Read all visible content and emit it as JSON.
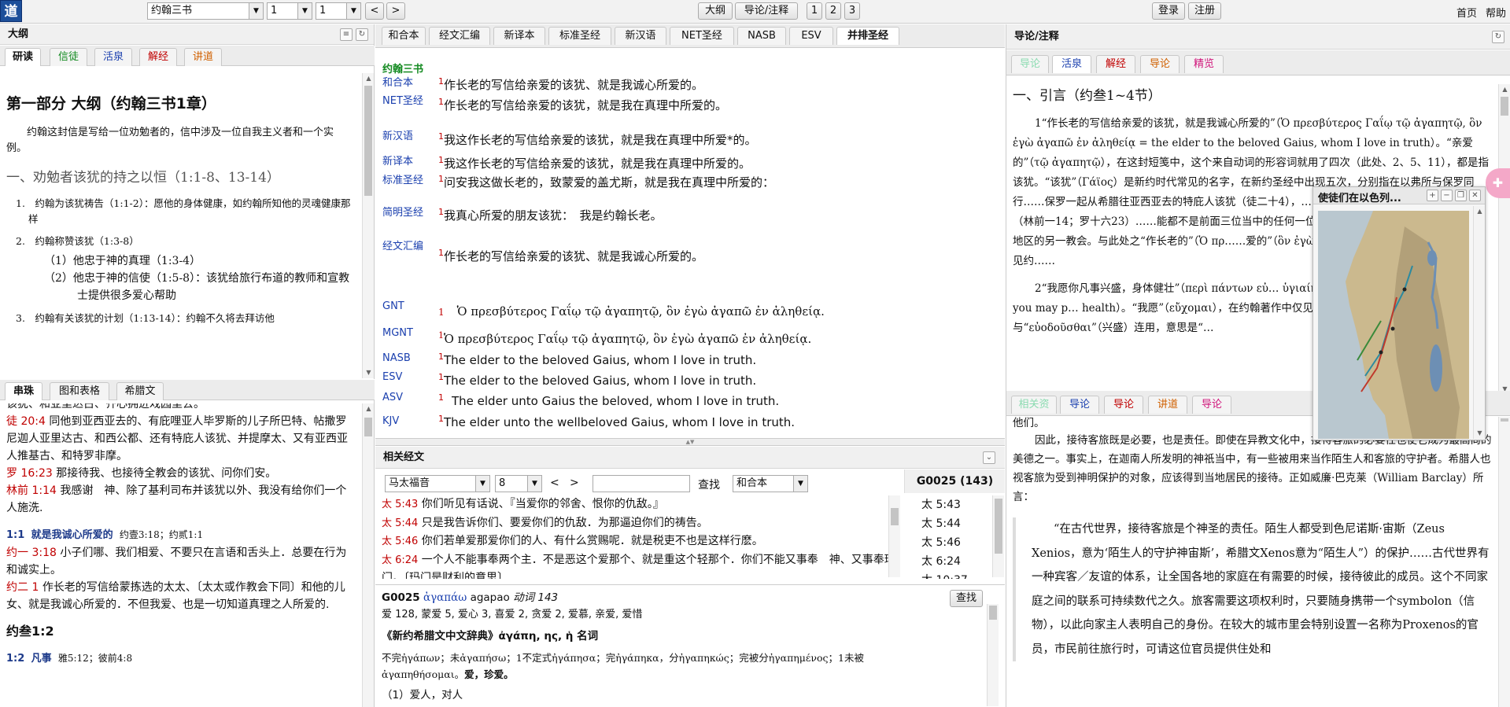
{
  "topbar": {
    "logo": "道",
    "book_select": "约翰三书",
    "chapter_select": "1",
    "verse_select": "1",
    "prev": "<",
    "next": ">",
    "outline_btn": "大纲",
    "commentary_btn": "导论/注释",
    "pages": [
      "1",
      "2",
      "3"
    ],
    "login": "登录",
    "register": "注册",
    "home": "首页",
    "help": "帮助"
  },
  "outline_panel": {
    "title": "大纲",
    "tabs": [
      "研读",
      "信徒",
      "活泉",
      "解经",
      "讲道"
    ],
    "heading": "第一部分 大纲（约翰三书1章）",
    "intro": "约翰这封信是写给一位劝勉者的，信中涉及一位自我主义者和一个实例。",
    "section1": "一、劝勉者该犹的持之以恒（1:1-8、13-14）",
    "item1": "1.　约翰为该犹祷告（1:1-2）：愿他的身体健康，如约翰所知他的灵魂健康那样",
    "item2": "2.　约翰称赞该犹（1:3-8）",
    "item2a": "（1）他忠于神的真理（1:3-4）",
    "item2b": "（2）他忠于神的信使（1:5-8）：该犹给旅行布道的教师和宣教士提供很多爱心帮助",
    "item3": "3.　约翰有关该犹的计划（1:13-14）：约翰不久将去拜访他"
  },
  "xref_panel": {
    "tabs": [
      "串珠",
      "图和表格",
      "希腊文"
    ],
    "line0": "该犹、和亚里达古、齐心拥进戏园里去。",
    "entries": [
      {
        "ref": "徒 20:4",
        "text": "同他到亚西亚去的、有庇哩亚人毕罗斯的儿子所巴特、帖撒罗尼迦人亚里达古、和西公都、还有特庇人该犹、并提摩太、又有亚西亚人推基古、和特罗非摩。"
      },
      {
        "ref": "罗 16:23",
        "text": "那接待我、也接待全教会的该犹、问你们安。"
      },
      {
        "ref": "林前 1:14",
        "text": "我感谢　神、除了基利司布并该犹以外、我没有给你们一个人施洗."
      }
    ],
    "v1_head": "1:1",
    "v1_title": "就是我诚心所爱的",
    "v1_refs": "约壹3:18；约贰1:1",
    "entries2": [
      {
        "ref": "约一 3:18",
        "text": "小子们哪、我们相爱、不要只在言语和舌头上．总要在行为和诚实上。"
      },
      {
        "ref": "约二 1",
        "text": "作长老的写信给蒙拣选的太太、〔太太或作教会下同〕和他的儿女、就是我诚心所爱的．不但我爱、也是一切知道真理之人所爱的."
      }
    ],
    "sub_head": "约叁1:2",
    "v2_head": "1:2",
    "v2_title": "凡事",
    "v2_refs": "雅5:12；彼前4:8"
  },
  "parallel_panel": {
    "tabs": [
      "和合本",
      "经文汇编",
      "新译本",
      "标准圣经",
      "新汉语",
      "NET圣经",
      "NASB",
      "ESV",
      "并排圣经"
    ],
    "book": "约翰三书",
    "rows": [
      {
        "version": "和合本",
        "num": "1",
        "text": "作长老的写信给亲爱的该犹、就是我诚心所爱的。"
      },
      {
        "version": "NET圣经",
        "num": "1",
        "text": "作长老的写信给亲爱的该犹，就是我在真理中所爱的。"
      },
      {
        "version": "新汉语",
        "num": "1",
        "text": "我这作长老的写信给亲爱的该犹，就是我在真理中所爱*的。"
      },
      {
        "version": "新译本",
        "num": "1",
        "text": "我这作长老的写信给亲爱的该犹，就是我在真理中所爱的。"
      },
      {
        "version": "标准圣经",
        "num": "1",
        "text": "问安我这做长老的，致蒙爱的盖尤斯，就是我在真理中所爱的："
      },
      {
        "version": "简明圣经",
        "num": "1",
        "text": "我真心所爱的朋友该犹：　我是约翰长老。"
      },
      {
        "version": "经文汇编",
        "num": "1",
        "text": "作长老的写信给亲爱的该犹、就是我诚心所爱的。"
      },
      {
        "version": "GNT",
        "num": "1",
        "text": "Ὁ πρεσβύτερος Γαΐῳ τῷ ἀγαπητῷ, ὃν ἐγὼ ἀγαπῶ ἐν ἀληθείᾳ."
      },
      {
        "version": "MGNT",
        "num": "1",
        "text": "Ὁ πρεσβύτερος Γαΐῳ τῷ ἀγαπητῷ, ὃν ἐγὼ ἀγαπῶ ἐν ἀληθείᾳ."
      },
      {
        "version": "NASB",
        "num": "1",
        "text": "The elder to the beloved Gaius, whom I love in truth."
      },
      {
        "version": "ESV",
        "num": "1",
        "text": "The elder to the beloved Gaius, whom I love in truth."
      },
      {
        "version": "ASV",
        "num": "1",
        "text": "The elder unto Gaius the beloved, whom I love in truth."
      },
      {
        "version": "KJV",
        "num": "1",
        "text": "The elder unto the wellbeloved Gaius, whom I love in truth."
      }
    ]
  },
  "related_panel": {
    "title": "相关经文",
    "book_select": "马太福音",
    "chapter_select": "8",
    "search_btn": "查找",
    "version_select": "和合本",
    "header": "G0025 (143)",
    "verses": [
      {
        "ref": "太 5:43",
        "text": "你们听见有话说、『当爱你的邻舍、恨你的仇敌。』"
      },
      {
        "ref": "太 5:44",
        "text": "只是我告诉你们、要爱你们的仇敌．为那逼迫你们的祷告。"
      },
      {
        "ref": "太 5:46",
        "text": "你们若单爱那爱你们的人、有什么赏赐呢．就是税吏不也是这样行麽。"
      },
      {
        "ref": "太 6:24",
        "text": "一个人不能事奉两个主．不是恶这个爱那个、就是重这个轻那个．你们不能又事奉　神、又事奉玛门。〔玛门是财利的意思〕"
      }
    ],
    "refs": [
      "太 5:43",
      "太 5:44",
      "太 5:46",
      "太 6:24",
      "太 10:37"
    ]
  },
  "lexicon_panel": {
    "search_btn": "查找",
    "head_code": "G0025",
    "head_greek": "ἀγαπάω",
    "head_trans": "agapao",
    "head_pos": "动词 143",
    "counts": "爱 128, 蒙爱 5, 爱心 3, 喜爱 2, 贪爱 2, 爱慕, 亲爱, 爱惜",
    "dict_title": "《新约希腊文中文辞典》ἀγάπη, ης, ἡ 名词",
    "forms": "不完ἠγάπων；未ἀγαπήσω；1不定式ἠγάπησα；完ἠγάπηκα，分ἠγαπηκώς；完被分ἠγαπημένος；1未被ἀγαπηθήσομαι。",
    "gloss": "爱，珍爱。",
    "line_last": "（1）爱人，对人"
  },
  "commentary_panel": {
    "title": "导论/注释",
    "tabs": [
      "导论",
      "活泉",
      "解经",
      "导论",
      "精览"
    ],
    "heading": "一、引言（约叁1~4节）",
    "p1": "1“作长老的写信给亲爱的该犹，就是我诚心所爱的”（Ὁ πρεσβύτερος Γαΐῳ τῷ ἀγαπητῷ, ὃν ἐγὼ ἀγαπῶ ἐν ἀληθείᾳ = the elder to the beloved Gaius, whom I love in truth）。“亲爱的”（τῷ ἀγαπητῷ），在这封短笺中，这个来自动词的形容词就用了四次（此处、2、5、11），都是指该犹。“该犹”（Γάϊος）是新约时代常见的名字，在新约圣经中出现五次，分别指在以弗所与保罗同行……保罗一起从希腊往亚西亚去的特庇人该犹（徒二十4），……马书时接待他并接待全教会的该犹（林前一14；罗十六23）……能都不是前面三位当中的任何一位。他可能是属于丢特腓……带领同一地区的另一教会。与此处之“作长老的”（Ὁ πρ……爱的”（ὃν ἐγὼ ἀγαπῶ ἐν ἀληθείᾳ）相同的词句，见约……",
    "p2": "2“我愿你凡事兴盛，身体健壮”（περὶ πάντων εὐ… ὑγιαίνειν = I pray that in all respects you may p… health）。“我愿”（εὔχομαι），在约翰著作中仅见于… πάντων），与“εὐοδοῦσθαι”（兴盛）连用，意思是“…",
    "tabs2": [
      "相关资",
      "导论",
      "导论",
      "讲道",
      "导论"
    ],
    "p3_start": "他们。",
    "p3": "因此，接待客旅既是必要，也是责任。即使在异教文化中，接待客旅的必要性也使它成为最高尚的美德之一。事实上，在迦南人所发明的神祇当中，有一些被用来当作陌生人和客旅的守护者。希腊人也视客旅为受到神明保护的对象，应该得到当地居民的接待。正如威廉·巴克莱（William Barclay）所言：",
    "quote": "“在古代世界，接待客旅是个神圣的责任。陌生人都受到色尼诺斯·宙斯（Zeus Xenios，意为‘陌生人的守护神宙斯’，希腊文Xenos意为“陌生人”）的保护……古代世界有一种宾客／友谊的体系，让全国各地的家庭在有需要的时候，接待彼此的成员。这个不同家庭之间的联系可持续数代之久。旅客需要这项权利时，只要随身携带一个symbolon（信物），以此向家主人表明自己的身份。在较大的城市里会特别设置一名称为Proxenos的官员，市民前往旅行时，可请这位官员提供住处和"
  },
  "map_window": {
    "title": "使徒们在以色列..."
  }
}
